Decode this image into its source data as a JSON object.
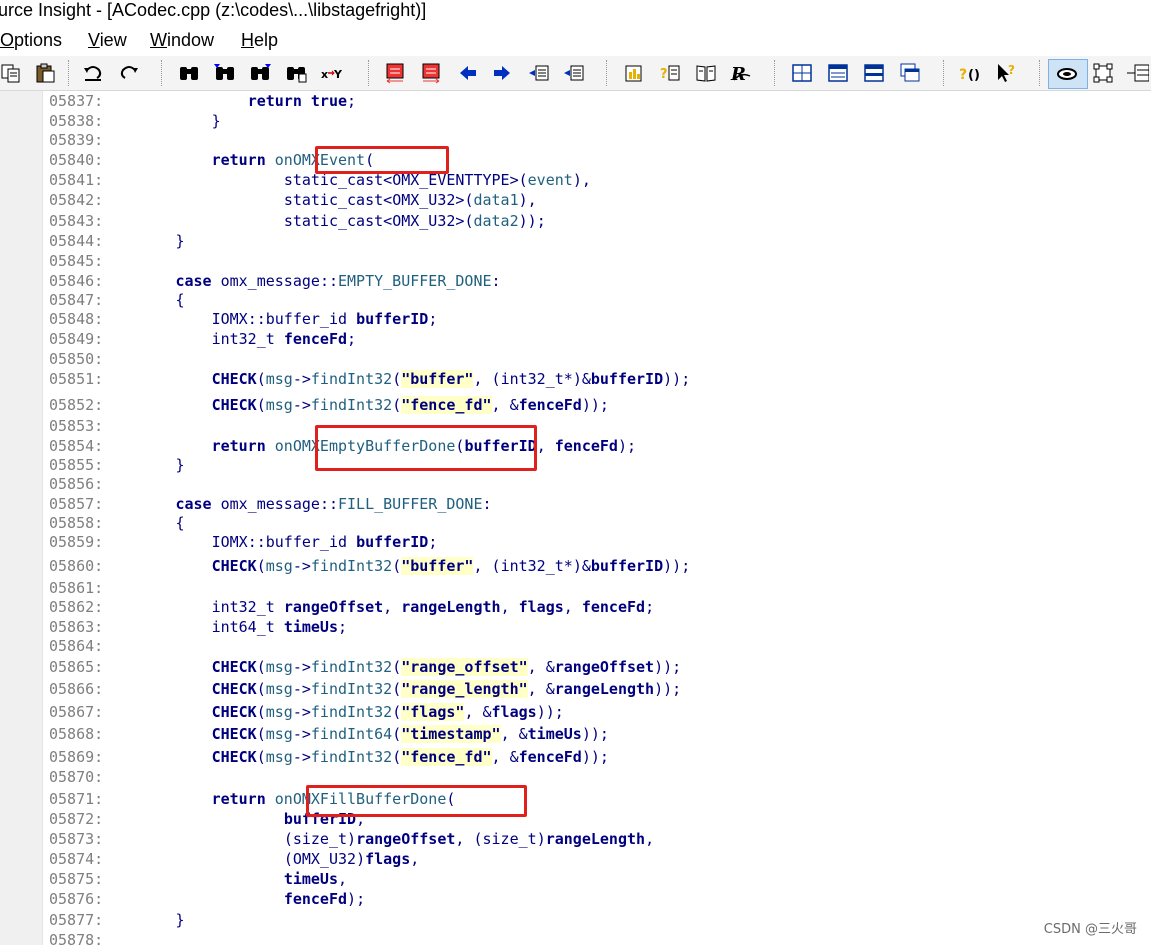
{
  "window": {
    "title": "urce Insight - [ACodec.cpp (z:\\codes\\...\\libstagefright)]"
  },
  "menu": [
    {
      "label": "Options",
      "u": "O"
    },
    {
      "label": "View",
      "u": "V"
    },
    {
      "label": "Window",
      "u": "W"
    },
    {
      "label": "Help",
      "u": "H"
    }
  ],
  "toolbar_icons": [
    "copy-icon",
    "paste-icon",
    "undo-icon",
    "redo-icon",
    "find-icon",
    "find-prev-icon",
    "find-next-icon",
    "find-files-icon",
    "replace-icon",
    "bookmark-prev-icon",
    "bookmark-next-icon",
    "back-icon",
    "forward-icon",
    "jump-in-icon",
    "jump-out-icon",
    "symbol-info-icon",
    "reference-icon",
    "book-icon",
    "relation-icon",
    "window-tile-icon",
    "window-list-icon",
    "window-split-icon",
    "window-cascade-icon",
    "context-icon",
    "pointer-help-icon",
    "lookup-icon",
    "relation-window-icon",
    "outline-icon"
  ],
  "code_lines": [
    {
      "n": "05837:",
      "t": "                return true;"
    },
    {
      "n": "05838:",
      "t": "            }"
    },
    {
      "n": "05839:",
      "t": ""
    },
    {
      "n": "05840:",
      "t": "            return onOMXEvent("
    },
    {
      "n": "05841:",
      "t": "                    static_cast<OMX_EVENTTYPE>(event),"
    },
    {
      "n": "05842:",
      "t": "                    static_cast<OMX_U32>(data1),"
    },
    {
      "n": "05843:",
      "t": "                    static_cast<OMX_U32>(data2));"
    },
    {
      "n": "05844:",
      "t": "        }"
    },
    {
      "n": "05845:",
      "t": ""
    },
    {
      "n": "05846:",
      "t": "        case omx_message::EMPTY_BUFFER_DONE:"
    },
    {
      "n": "05847:",
      "t": "        {"
    },
    {
      "n": "05848:",
      "t": "            IOMX::buffer_id bufferID;"
    },
    {
      "n": "05849:",
      "t": "            int32_t fenceFd;"
    },
    {
      "n": "05850:",
      "t": ""
    },
    {
      "n": "05851:",
      "t": "            CHECK(msg->findInt32(\"buffer\", (int32_t*)&bufferID));"
    },
    {
      "n": "05852:",
      "t": "            CHECK(msg->findInt32(\"fence_fd\", &fenceFd));"
    },
    {
      "n": "05853:",
      "t": ""
    },
    {
      "n": "05854:",
      "t": "            return onOMXEmptyBufferDone(bufferID, fenceFd);"
    },
    {
      "n": "05855:",
      "t": "        }"
    },
    {
      "n": "05856:",
      "t": ""
    },
    {
      "n": "05857:",
      "t": "        case omx_message::FILL_BUFFER_DONE:"
    },
    {
      "n": "05858:",
      "t": "        {"
    },
    {
      "n": "05859:",
      "t": "            IOMX::buffer_id bufferID;"
    },
    {
      "n": "05860:",
      "t": "            CHECK(msg->findInt32(\"buffer\", (int32_t*)&bufferID));"
    },
    {
      "n": "05861:",
      "t": ""
    },
    {
      "n": "05862:",
      "t": "            int32_t rangeOffset, rangeLength, flags, fenceFd;"
    },
    {
      "n": "05863:",
      "t": "            int64_t timeUs;"
    },
    {
      "n": "05864:",
      "t": ""
    },
    {
      "n": "05865:",
      "t": "            CHECK(msg->findInt32(\"range_offset\", &rangeOffset));"
    },
    {
      "n": "05866:",
      "t": "            CHECK(msg->findInt32(\"range_length\", &rangeLength));"
    },
    {
      "n": "05867:",
      "t": "            CHECK(msg->findInt32(\"flags\", &flags));"
    },
    {
      "n": "05868:",
      "t": "            CHECK(msg->findInt64(\"timestamp\", &timeUs));"
    },
    {
      "n": "05869:",
      "t": "            CHECK(msg->findInt32(\"fence_fd\", &fenceFd));"
    },
    {
      "n": "05870:",
      "t": ""
    },
    {
      "n": "05871:",
      "t": "            return onOMXFillBufferDone("
    },
    {
      "n": "05872:",
      "t": "                    bufferID,"
    },
    {
      "n": "05873:",
      "t": "                    (size_t)rangeOffset, (size_t)rangeLength,"
    },
    {
      "n": "05874:",
      "t": "                    (OMX_U32)flags,"
    },
    {
      "n": "05875:",
      "t": "                    timeUs,"
    },
    {
      "n": "05876:",
      "t": "                    fenceFd);"
    },
    {
      "n": "05877:",
      "t": "        }"
    },
    {
      "n": "05878:",
      "t": ""
    }
  ],
  "highlights": [
    "onOMXEvent(",
    "onOMXEmptyBufferDone",
    "onOMXFillBufferDone"
  ],
  "watermark": "CSDN @三火哥",
  "colors": {
    "keyword": "#00007f",
    "line_number": "#7f7f7f",
    "highlight_box": "#e0201c",
    "string_bg": "#ffffc8"
  }
}
